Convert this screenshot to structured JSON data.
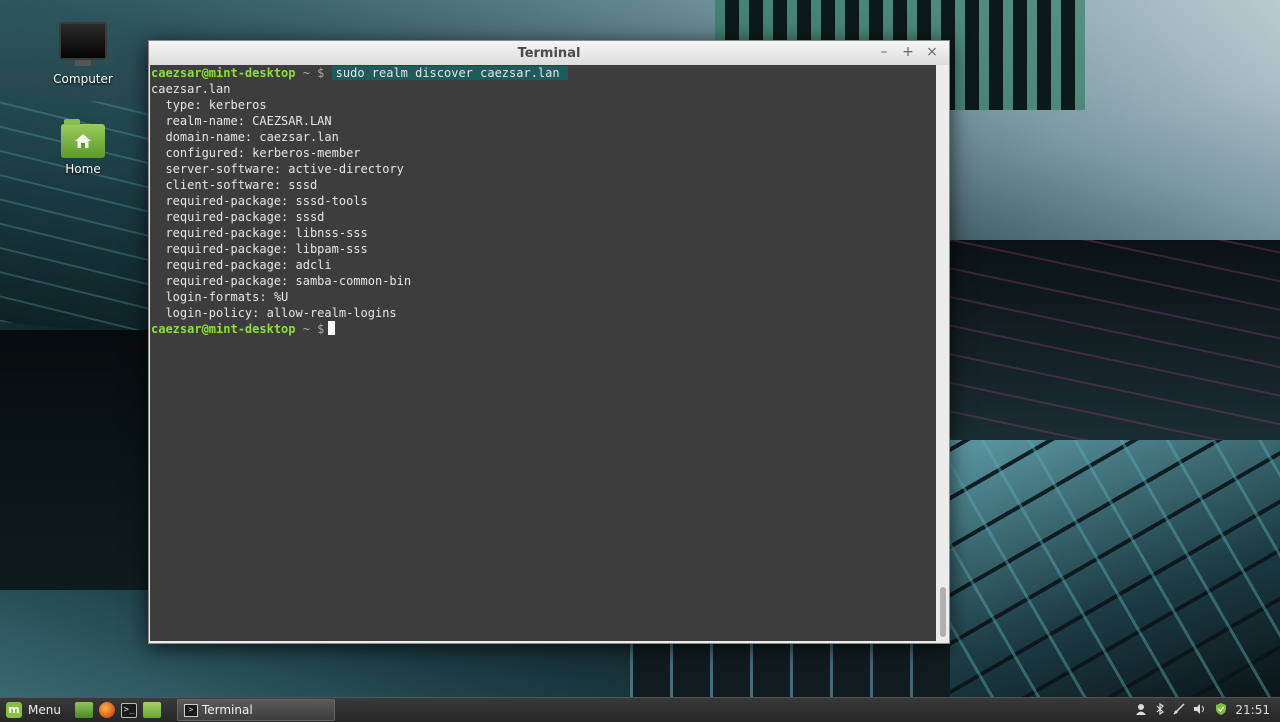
{
  "desktop": {
    "icons": [
      {
        "label": "Computer",
        "icon": "computer-icon"
      },
      {
        "label": "Home",
        "icon": "home-folder-icon"
      }
    ]
  },
  "window": {
    "title": "Terminal",
    "controls": {
      "minimize": "–",
      "maximize": "+",
      "close": "×"
    }
  },
  "terminal": {
    "prompt_user": "caezsar@mint-desktop",
    "prompt_sep": " ~ $",
    "command": "sudo realm discover caezsar.lan",
    "output": [
      "caezsar.lan",
      "  type: kerberos",
      "  realm-name: CAEZSAR.LAN",
      "  domain-name: caezsar.lan",
      "  configured: kerberos-member",
      "  server-software: active-directory",
      "  client-software: sssd",
      "  required-package: sssd-tools",
      "  required-package: sssd",
      "  required-package: libnss-sss",
      "  required-package: libpam-sss",
      "  required-package: adcli",
      "  required-package: samba-common-bin",
      "  login-formats: %U",
      "  login-policy: allow-realm-logins"
    ]
  },
  "taskbar": {
    "menu_label": "Menu",
    "launchers": [
      "show-desktop-icon",
      "firefox-icon",
      "terminal-icon",
      "files-icon"
    ],
    "tasks": [
      {
        "label": "Terminal",
        "icon": "terminal-icon"
      }
    ],
    "tray": [
      "user-icon",
      "bluetooth-icon",
      "network-icon",
      "volume-icon",
      "shield-icon"
    ],
    "clock": "21:51"
  },
  "colors": {
    "prompt_green": "#8ae234",
    "command_highlight": "#1c5c5a",
    "terminal_bg": "#2f2f2f"
  }
}
